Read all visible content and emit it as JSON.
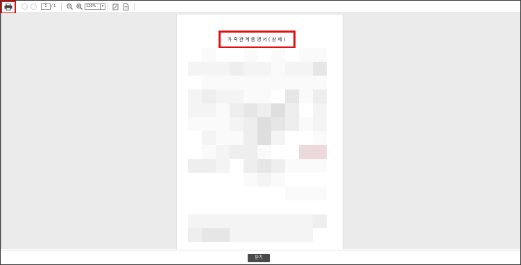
{
  "toolbar": {
    "page_current": "1",
    "page_total": "/ 1",
    "zoom_value": "120%",
    "icons": [
      "print-icon",
      "prev-page-icon",
      "next-page-icon",
      "zoom-out-icon",
      "zoom-in-icon",
      "fit-page-icon",
      "document-icon"
    ]
  },
  "document": {
    "title": "가족관계증명서(상세)"
  },
  "footer": {
    "close_label": "닫기"
  },
  "colors": {
    "highlight": "#e01010",
    "viewer_bg": "#ebebeb",
    "button_bg": "#4a4a4a"
  }
}
